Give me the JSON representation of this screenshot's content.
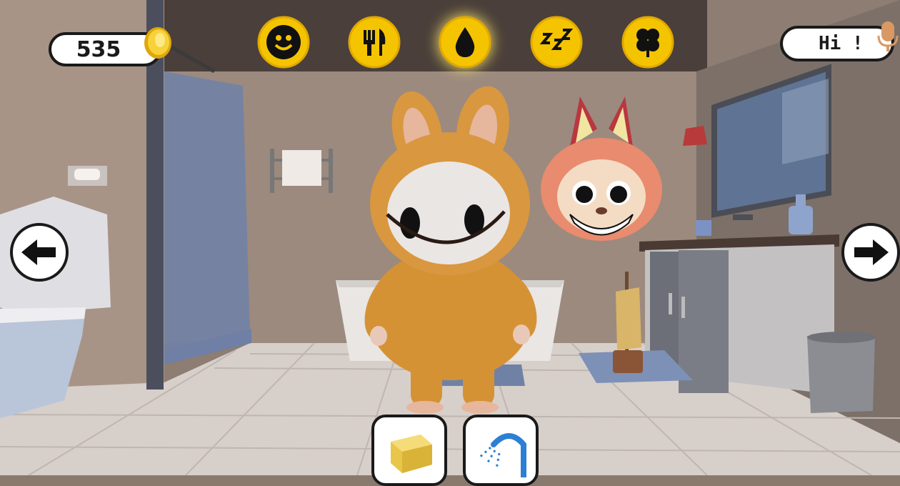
{
  "game": {
    "coins": "535",
    "speech_text": "Hi !",
    "room": "bathroom"
  },
  "needs": [
    {
      "name": "happiness",
      "icon": "smiley-icon",
      "active": false
    },
    {
      "name": "food",
      "icon": "fork-knife-icon",
      "active": false
    },
    {
      "name": "hygiene",
      "icon": "water-drop-icon",
      "active": true
    },
    {
      "name": "sleep",
      "icon": "zzz-icon",
      "active": false
    },
    {
      "name": "luck",
      "icon": "clover-icon",
      "active": false
    }
  ],
  "navigation": {
    "previous_room": "left-arrow-icon",
    "next_room": "right-arrow-icon"
  },
  "tools": [
    {
      "name": "soap",
      "icon": "soap-bar-icon"
    },
    {
      "name": "shower",
      "icon": "shower-head-icon"
    }
  ],
  "colors": {
    "need_badge": "#f5c400",
    "accent_glow": "#ffe96a",
    "character_fur": "#d9973f",
    "hud_outline": "#1a1a1a"
  }
}
